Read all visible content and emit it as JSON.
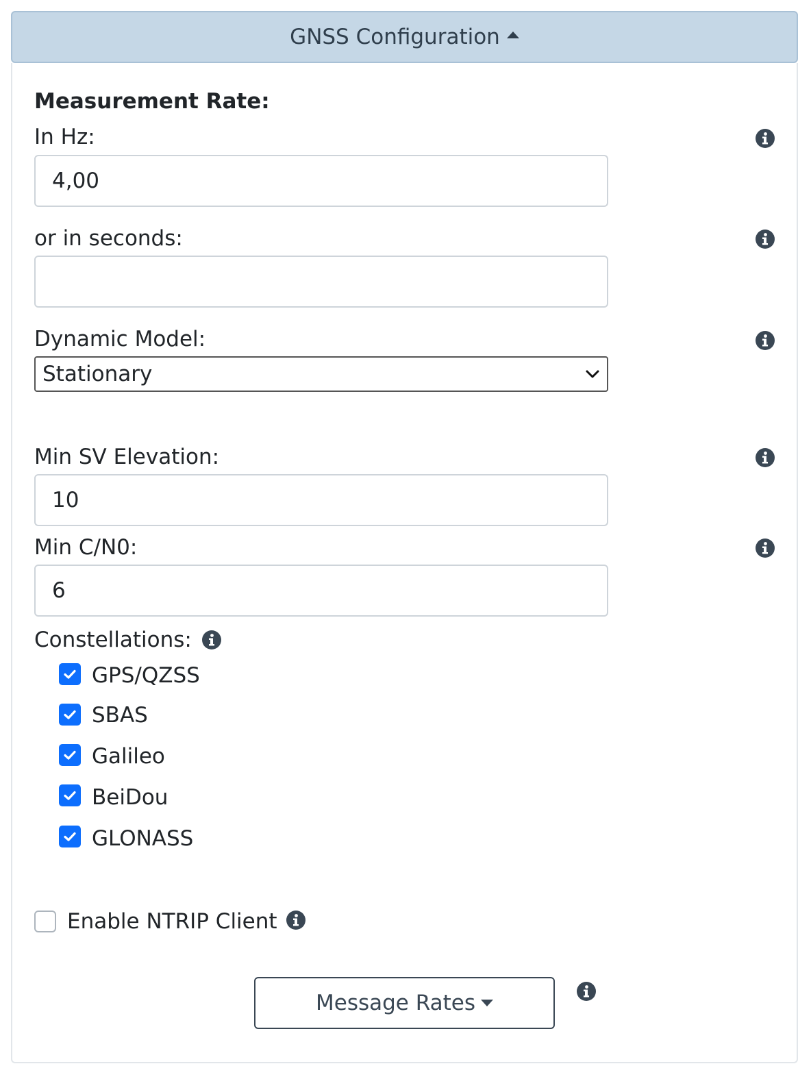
{
  "header": {
    "title": "GNSS Configuration"
  },
  "measurement": {
    "section_label": "Measurement Rate:",
    "hz_label": "In Hz:",
    "hz_value": "4,00",
    "seconds_label": "or in seconds:",
    "seconds_value": ""
  },
  "dynamic_model": {
    "label": "Dynamic Model:",
    "selected": "Stationary"
  },
  "min_sv_elevation": {
    "label": "Min SV Elevation:",
    "value": "10"
  },
  "min_cn0": {
    "label": "Min C/N0:",
    "value": "6"
  },
  "constellations": {
    "label": "Constellations:",
    "items": [
      {
        "label": "GPS/QZSS",
        "checked": true
      },
      {
        "label": "SBAS",
        "checked": true
      },
      {
        "label": "Galileo",
        "checked": true
      },
      {
        "label": "BeiDou",
        "checked": true
      },
      {
        "label": "GLONASS",
        "checked": true
      }
    ]
  },
  "ntrip": {
    "label": "Enable NTRIP Client",
    "checked": false
  },
  "message_rates": {
    "label": "Message Rates"
  },
  "colors": {
    "header_bg": "#c5d7e6",
    "checkbox_blue": "#0d6efd",
    "icon": "#3a4754"
  },
  "icons": {
    "info": "info-circle-icon",
    "collapse": "caret-up-icon",
    "expand": "caret-down-icon",
    "select": "chevron-down-icon",
    "check": "checkmark-icon"
  }
}
